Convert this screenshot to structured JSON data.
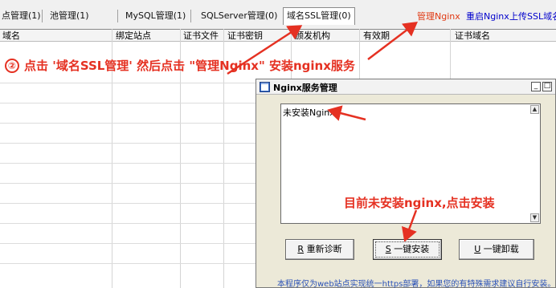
{
  "tabs": [
    {
      "label": "点管理(1)"
    },
    {
      "label": "池管理(1)"
    },
    {
      "label": "MySQL管理(1)"
    },
    {
      "label": "SQLServer管理(0)"
    },
    {
      "label": "域名SSL管理(0)"
    }
  ],
  "toolbar_links": {
    "manage_nginx": "管理Nginx",
    "restart_nginx": "重启Nginx",
    "upload_ssl": "上传SSL域名"
  },
  "columns": [
    "域名",
    "绑定站点",
    "证书文件",
    "证书密钥",
    "颁发机构",
    "有效期",
    "证书域名"
  ],
  "annotations": {
    "step_number": "②",
    "step_text": "点击 '域名SSL管理' 然后点击 \"管理Nginx\" 安装nginx服务",
    "install_hint": "目前未安装nginx,点击安装"
  },
  "dialog": {
    "title": "Nginx服务管理",
    "minimize_glyph": "_",
    "maximize_glyph": "□",
    "status_text": "未安装Nginx",
    "scroll_up_glyph": "▲",
    "scroll_down_glyph": "▼",
    "buttons": {
      "rediagnose": {
        "key": "R",
        "label": "重新诊断"
      },
      "install": {
        "key": "S",
        "label": "一键安装"
      },
      "uninstall": {
        "key": "U",
        "label": "一键卸载"
      }
    },
    "footnote": "本程序仅为web站点实现统一https部署，如果您的有特殊需求建议自行安装。"
  },
  "colors": {
    "annotation_red": "#e53122",
    "link_blue": "#0000cc",
    "link_red": "#e03a14",
    "footnote_blue": "#2b52b8"
  }
}
